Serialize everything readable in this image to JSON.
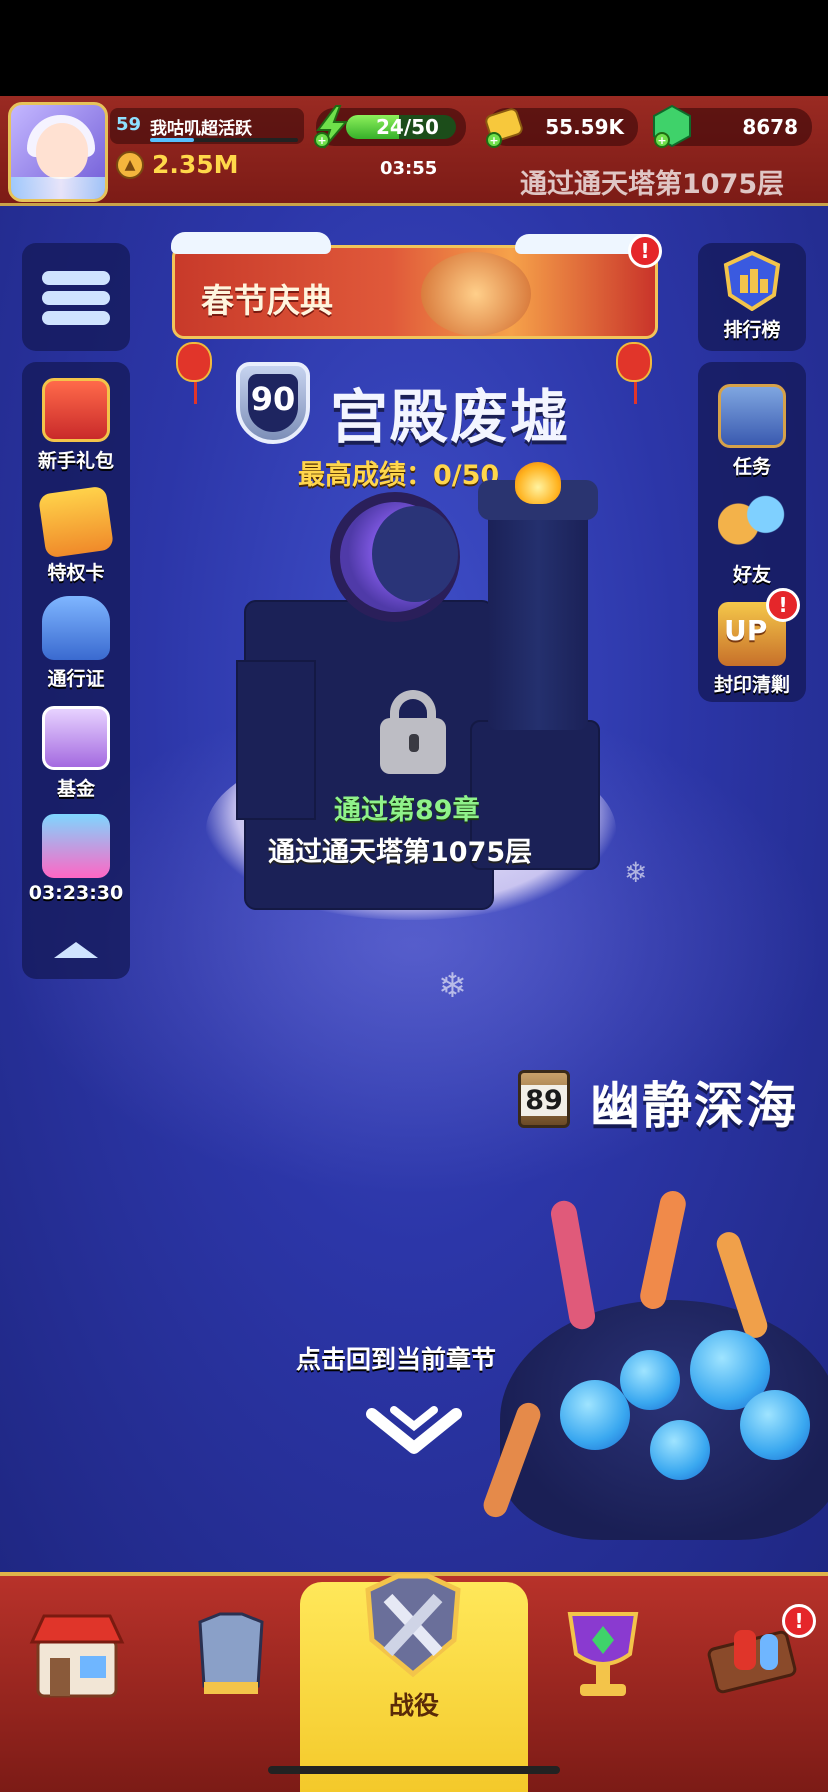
{
  "player": {
    "level": "59",
    "name": "我咕叽超活跃",
    "power": "2.35M",
    "xp_fraction": 0.3
  },
  "resources": {
    "energy": "24/50",
    "energy_fraction": 0.48,
    "energy_timer": "03:55",
    "gold": "55.59K",
    "gems": "8678"
  },
  "top_banner": "通过通天塔第1075层",
  "festival": {
    "title": "春节庆典",
    "badge": "!"
  },
  "left_menu": {
    "items": [
      {
        "label": "新手礼包"
      },
      {
        "label": "特权卡"
      },
      {
        "label": "通行证"
      },
      {
        "label": "基金"
      }
    ],
    "offer_timer": "03:23:30"
  },
  "right_menu": {
    "leaderboard": "排行榜",
    "items": [
      {
        "label": "任务"
      },
      {
        "label": "好友"
      },
      {
        "label": "封印清剿",
        "badge": "!"
      }
    ]
  },
  "chapter": {
    "number": "90",
    "title": "宫殿废墟",
    "best_score": "最高成绩：0/50",
    "unlock_req_1": "通过第89章",
    "unlock_req_2": "通过通天塔第1075层"
  },
  "next_chapter": {
    "number": "89",
    "title": "幽静深海"
  },
  "return_prompt": "点击回到当前章节",
  "bottom_nav": {
    "active_label": "战役",
    "badge": "!"
  },
  "colors": {
    "accent_gold": "#ffd84a",
    "unlock_green": "#8ff28a",
    "badge_red": "#e5262a",
    "nav_active": "#f4c92a"
  }
}
